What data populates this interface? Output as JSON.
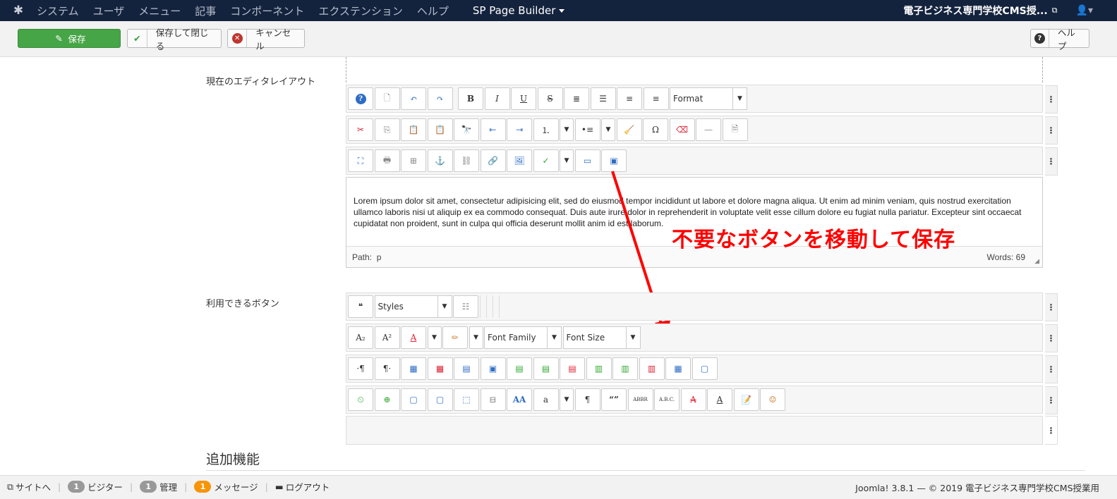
{
  "navbar": {
    "menu": [
      "システム",
      "ユーザ",
      "メニュー",
      "記事",
      "コンポーネント",
      "エクステンション",
      "ヘルプ"
    ],
    "sp_page_builder": "SP Page Builder",
    "site_name": "電子ビジネス専門学校CMS授..."
  },
  "toolbar": {
    "save": "保存",
    "save_close": "保存して閉じる",
    "cancel": "キャンセル",
    "help": "ヘルプ"
  },
  "labels": {
    "current_layout": "現在のエディタレイアウト",
    "available_buttons": "利用できるボタン",
    "additional_features": "追加機能"
  },
  "selects": {
    "format": "Format",
    "styles": "Styles",
    "font_family": "Font Family",
    "font_size": "Font Size"
  },
  "editor": {
    "content": "Lorem ipsum dolor sit amet, consectetur adipisicing elit, sed do eiusmod tempor incididunt ut labore et dolore magna aliqua. Ut enim ad minim veniam, quis nostrud exercitation ullamco laboris nisi ut aliquip ex ea commodo consequat. Duis aute irure dolor in reprehenderit in voluptate velit esse cillum dolore eu fugiat nulla pariatur. Excepteur sint occaecat cupidatat non proident, sunt in culpa qui officia deserunt mollit anim id est laborum.",
    "path_label": "Path:",
    "path_value": "p",
    "words": "Words: 69"
  },
  "annotation": "不要なボタンを移動して保存",
  "statusbar": {
    "site": "サイトへ",
    "visitors_count": "1",
    "visitors": "ビジター",
    "admin_count": "1",
    "admin": "管理",
    "messages_count": "1",
    "messages": "メッセージ",
    "logout": "ログアウト",
    "footer": "Joomla! 3.8.1 — © 2019 電子ビジネス専門学校CMS授業用"
  },
  "colors": {
    "navbar": "#14233d",
    "save_button": "#46a546",
    "annotation": "#ff0000",
    "badge_orange": "#f89406"
  }
}
